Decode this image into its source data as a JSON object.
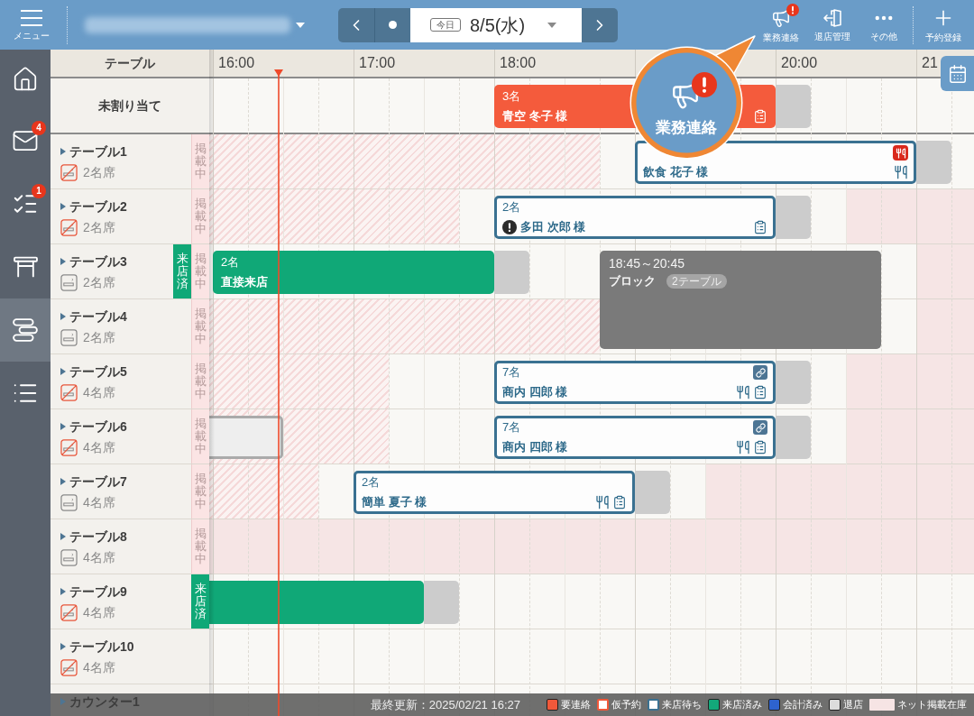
{
  "top_bar": {
    "menu_label": "メニュー",
    "date_nav": {
      "today_label": "今日",
      "date": "8/5(水)"
    },
    "actions": [
      {
        "kind": "megaphone",
        "label": "業務連絡",
        "alert": true
      },
      {
        "kind": "exit",
        "label": "退店管理",
        "alert": false
      },
      {
        "kind": "more",
        "label": "その他",
        "alert": false
      },
      {
        "kind": "add",
        "label": "予約登録",
        "alert": false
      }
    ]
  },
  "sidebar": {
    "items": [
      {
        "kind": "home",
        "selected": false
      },
      {
        "kind": "mail",
        "selected": false,
        "badge": "4"
      },
      {
        "kind": "checklist",
        "selected": false,
        "badge": "1"
      },
      {
        "kind": "table",
        "selected": false
      },
      {
        "kind": "timeline",
        "selected": true
      },
      {
        "kind": "list",
        "selected": false
      }
    ]
  },
  "timeline": {
    "column_header": "テーブル",
    "hours": [
      "16:00",
      "17:00",
      "18:00",
      "20:00",
      "21"
    ],
    "unassigned": {
      "label": "未割り当て",
      "reservations": [
        {
          "kind": "needs_contact",
          "party": "3名",
          "name": "青空 冬子 様",
          "flagged": false,
          "icons_bottom": [
            {
              "kind": "memo"
            }
          ]
        }
      ]
    },
    "rows": [
      {
        "name": "テーブル1",
        "seats": "2名席",
        "smoking": false,
        "tags": [
          {
            "kind": "listed",
            "label": "掲載中"
          }
        ],
        "zones": [
          {
            "kind": "hatched"
          }
        ],
        "reservations": [
          {
            "kind": "waiting",
            "name": "飲食 花子 様",
            "flagged": false,
            "icons_top": [
              {
                "kind": "restaurant"
              }
            ],
            "icons_bottom": [
              {
                "kind": "cutlery"
              }
            ]
          }
        ]
      },
      {
        "name": "テーブル2",
        "seats": "2名席",
        "smoking": false,
        "tags": [
          {
            "kind": "listed",
            "label": "掲載中"
          }
        ],
        "zones": [
          {
            "kind": "hatched"
          },
          {
            "kind": "solid"
          }
        ],
        "reservations": [
          {
            "kind": "waiting",
            "party": "2名",
            "name": "多田 次郎 様",
            "flagged": true,
            "icons_bottom": [
              {
                "kind": "memo"
              }
            ]
          }
        ]
      },
      {
        "name": "テーブル3",
        "seats": "2名席",
        "smoking": true,
        "tags": [
          {
            "kind": "visited",
            "label": "来店済"
          },
          {
            "kind": "listed",
            "label": "掲載中"
          }
        ],
        "zones": [
          {
            "kind": "solid"
          }
        ],
        "reservations": [
          {
            "kind": "visited",
            "party": "2名",
            "name": "直接来店",
            "flagged": false
          },
          {
            "kind": "blocked",
            "time_label": "18:45～20:45",
            "name": "ブロック",
            "pill": "2テーブル",
            "continues_below": true
          }
        ]
      },
      {
        "name": "テーブル4",
        "seats": "2名席",
        "smoking": true,
        "tags": [
          {
            "kind": "listed",
            "label": "掲載中"
          }
        ],
        "zones": [
          {
            "kind": "hatched"
          },
          {
            "kind": "solid"
          }
        ]
      },
      {
        "name": "テーブル5",
        "seats": "4名席",
        "smoking": false,
        "tags": [
          {
            "kind": "listed",
            "label": "掲載中"
          }
        ],
        "zones": [
          {
            "kind": "hatched"
          },
          {
            "kind": "solid"
          }
        ],
        "reservations": [
          {
            "kind": "waiting",
            "party": "7名",
            "name": "商内 四郎 様",
            "flagged": false,
            "icons_top": [
              {
                "kind": "link"
              }
            ],
            "icons_bottom": [
              {
                "kind": "cutlery"
              },
              {
                "kind": "memo"
              }
            ]
          }
        ]
      },
      {
        "name": "テーブル6",
        "seats": "4名席",
        "smoking": false,
        "tags": [
          {
            "kind": "listed",
            "label": "掲載中"
          }
        ],
        "zones": [
          {
            "kind": "hatched"
          },
          {
            "kind": "solid"
          }
        ],
        "reservations": [
          {
            "kind": "departed"
          },
          {
            "kind": "waiting",
            "party": "7名",
            "name": "商内 四郎 様",
            "flagged": false,
            "icons_top": [
              {
                "kind": "link"
              }
            ],
            "icons_bottom": [
              {
                "kind": "cutlery"
              },
              {
                "kind": "memo"
              }
            ]
          }
        ]
      },
      {
        "name": "テーブル7",
        "seats": "4名席",
        "smoking": true,
        "tags": [
          {
            "kind": "listed",
            "label": "掲載中"
          }
        ],
        "zones": [
          {
            "kind": "hatched"
          },
          {
            "kind": "solid"
          }
        ],
        "reservations": [
          {
            "kind": "waiting",
            "party": "2名",
            "name": "簡単 夏子 様",
            "flagged": false,
            "icons_bottom": [
              {
                "kind": "cutlery"
              },
              {
                "kind": "memo"
              }
            ]
          }
        ]
      },
      {
        "name": "テーブル8",
        "seats": "4名席",
        "smoking": true,
        "tags": [
          {
            "kind": "listed",
            "label": "掲載中"
          }
        ],
        "zones": [
          {
            "kind": "solid"
          }
        ]
      },
      {
        "name": "テーブル9",
        "seats": "4名席",
        "smoking": false,
        "tags": [
          {
            "kind": "visited",
            "label": "来店済"
          }
        ],
        "reservations": [
          {
            "kind": "visited"
          }
        ]
      },
      {
        "name": "テーブル10",
        "seats": "4名席",
        "smoking": false
      },
      {
        "name": "カウンター1"
      }
    ]
  },
  "callout": {
    "label": "業務連絡",
    "alert": true
  },
  "status_bar": {
    "last_updated": "最終更新：2025/02/21 16:27",
    "legend": [
      {
        "label": "要連絡",
        "kind": "filled",
        "color": "#f0583a"
      },
      {
        "label": "仮予約",
        "kind": "outlined",
        "color": "#f0583a"
      },
      {
        "label": "来店待ち",
        "kind": "outlined",
        "color": "#3b7191"
      },
      {
        "label": "来店済み",
        "kind": "filled",
        "color": "#13a87a"
      },
      {
        "label": "会計済み",
        "kind": "filled",
        "color": "#2e63cf"
      },
      {
        "label": "退店",
        "kind": "filled",
        "color": "#dcdcdc"
      },
      {
        "label": "ネット掲載在庫",
        "kind": "wide",
        "color": "#f6e4e4"
      }
    ]
  }
}
